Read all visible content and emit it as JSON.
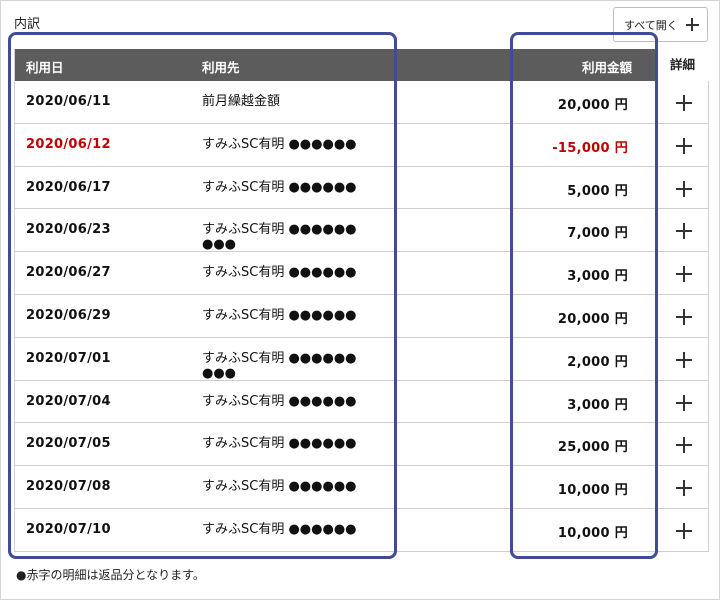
{
  "section_title": "内訳",
  "expand_all_label": "すべて開く",
  "table": {
    "headers": {
      "date": "利用日",
      "merchant": "利用先",
      "amount": "利用金額",
      "detail": "詳細"
    },
    "rows": [
      {
        "date": "2020/06/11",
        "merchant": "前月繰越金額",
        "amount": "20,000 円",
        "negative": false
      },
      {
        "date": "2020/06/12",
        "merchant": "すみふSC有明 ●●●●●●",
        "amount": "-15,000 円",
        "negative": true
      },
      {
        "date": "2020/06/17",
        "merchant": "すみふSC有明 ●●●●●●",
        "amount": "5,000 円",
        "negative": false
      },
      {
        "date": "2020/06/23",
        "merchant": "すみふSC有明 ●●●●●● ●●●",
        "amount": "7,000 円",
        "negative": false
      },
      {
        "date": "2020/06/27",
        "merchant": "すみふSC有明 ●●●●●●",
        "amount": "3,000 円",
        "negative": false
      },
      {
        "date": "2020/06/29",
        "merchant": "すみふSC有明 ●●●●●●",
        "amount": "20,000 円",
        "negative": false
      },
      {
        "date": "2020/07/01",
        "merchant": "すみふSC有明 ●●●●●● ●●●",
        "amount": "2,000 円",
        "negative": false
      },
      {
        "date": "2020/07/04",
        "merchant": "すみふSC有明 ●●●●●●",
        "amount": "3,000 円",
        "negative": false
      },
      {
        "date": "2020/07/05",
        "merchant": "すみふSC有明 ●●●●●●",
        "amount": "25,000 円",
        "negative": false
      },
      {
        "date": "2020/07/08",
        "merchant": "すみふSC有明 ●●●●●●",
        "amount": "10,000 円",
        "negative": false
      },
      {
        "date": "2020/07/10",
        "merchant": "すみふSC有明 ●●●●●●",
        "amount": "10,000 円",
        "negative": false
      }
    ]
  },
  "footnote": "●赤字の明細は返品分となります。",
  "colors": {
    "header_bg": "#5c5c5c",
    "negative": "#c00000",
    "highlight": "#414b96"
  },
  "icons": {
    "expand": "plus-icon",
    "row_detail": "plus-icon"
  }
}
